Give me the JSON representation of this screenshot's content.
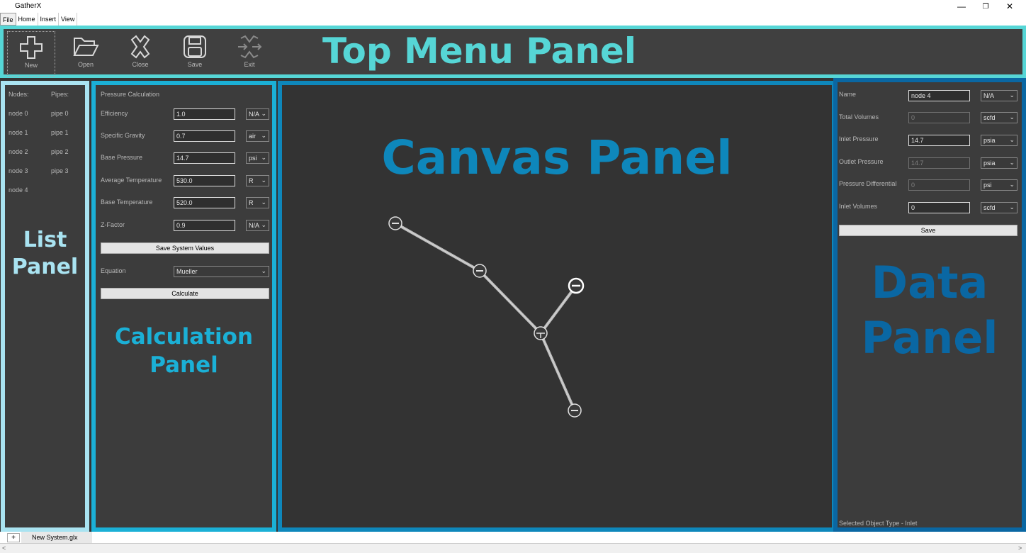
{
  "window": {
    "title": "GatherX",
    "minimize": "—",
    "maximize": "❐",
    "close": "✕"
  },
  "menu": [
    "File",
    "Home",
    "Insert",
    "View"
  ],
  "toolbar": {
    "heading": "Top Menu Panel",
    "buttons": [
      {
        "label": "New",
        "icon": "plus-icon"
      },
      {
        "label": "Open",
        "icon": "folder-icon"
      },
      {
        "label": "Close",
        "icon": "close-x-icon"
      },
      {
        "label": "Save",
        "icon": "save-disk-icon"
      },
      {
        "label": "Exit",
        "icon": "exit-icon"
      }
    ]
  },
  "list_panel": {
    "heading_line1": "List",
    "heading_line2": "Panel",
    "nodes_header": "Nodes:",
    "pipes_header": "Pipes:",
    "nodes": [
      "node 0",
      "node 1",
      "node 2",
      "node 3",
      "node 4"
    ],
    "pipes": [
      "pipe 0",
      "pipe 1",
      "pipe 2",
      "pipe 3"
    ]
  },
  "calc_panel": {
    "title": "Pressure Calculation",
    "heading_line1": "Calculation",
    "heading_line2": "Panel",
    "fields": [
      {
        "label": "Efficiency",
        "value": "1.0",
        "unit": "N/A"
      },
      {
        "label": "Specific Gravity",
        "value": "0.7",
        "unit": "air"
      },
      {
        "label": "Base Pressure",
        "value": "14.7",
        "unit": "psi"
      },
      {
        "label": "Average Temperature",
        "value": "530.0",
        "unit": "R"
      },
      {
        "label": "Base Temperature",
        "value": "520.0",
        "unit": "R"
      },
      {
        "label": "Z-Factor",
        "value": "0.9",
        "unit": "N/A"
      }
    ],
    "save_button": "Save System Values",
    "equation_label": "Equation",
    "equation_value": "Mueller",
    "calculate_button": "Calculate"
  },
  "canvas_panel": {
    "heading": "Canvas Panel"
  },
  "data_panel": {
    "heading_line1": "Data",
    "heading_line2": "Panel",
    "fields": [
      {
        "label": "Name",
        "value": "node 4",
        "unit": "N/A",
        "enabled": true
      },
      {
        "label": "Total Volumes",
        "value": "0",
        "unit": "scfd",
        "enabled": false
      },
      {
        "label": "Inlet Pressure",
        "value": "14.7",
        "unit": "psia",
        "enabled": true
      },
      {
        "label": "Outlet Pressure",
        "value": "14.7",
        "unit": "psia",
        "enabled": false
      },
      {
        "label": "Pressure Differential",
        "value": "0",
        "unit": "psi",
        "enabled": false
      },
      {
        "label": "Inlet Volumes",
        "value": "0",
        "unit": "scfd",
        "enabled": true
      }
    ],
    "save_button": "Save",
    "selected_type": "Selected Object Type - Inlet"
  },
  "tabs": {
    "add": "+",
    "document": "New System.glx"
  },
  "colors": {
    "top_border": "#56d6d6",
    "list_border": "#a9e3f1",
    "calc_border": "#1bb0d6",
    "canvas_border": "#0e87bb",
    "data_border": "#0a67a3"
  }
}
